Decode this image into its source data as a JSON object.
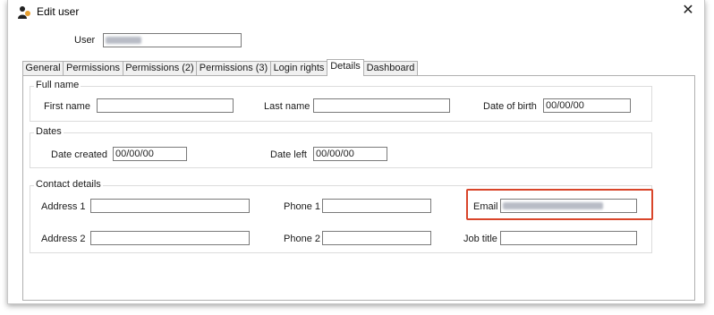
{
  "window": {
    "title": "Edit user",
    "icon": "users-icon",
    "close_glyph": "✕"
  },
  "user": {
    "label": "User",
    "value_blurred": true
  },
  "tabs": [
    {
      "label": "General"
    },
    {
      "label": "Permissions"
    },
    {
      "label": "Permissions (2)"
    },
    {
      "label": "Permissions (3)"
    },
    {
      "label": "Login rights"
    },
    {
      "label": "Details",
      "active": true
    },
    {
      "label": "Dashboard"
    }
  ],
  "full_name": {
    "title": "Full name",
    "first_name_label": "First name",
    "first_name_value": "",
    "last_name_label": "Last name",
    "last_name_value": "",
    "dob_label": "Date of birth",
    "dob_value": "00/00/00"
  },
  "dates": {
    "title": "Dates",
    "created_label": "Date created",
    "created_value": "00/00/00",
    "left_label": "Date left",
    "left_value": "00/00/00"
  },
  "contact": {
    "title": "Contact details",
    "address1_label": "Address 1",
    "address1_value": "",
    "phone1_label": "Phone 1",
    "phone1_value": "",
    "email_label": "Email",
    "email_value_blurred": true,
    "address2_label": "Address 2",
    "address2_value": "",
    "phone2_label": "Phone 2",
    "phone2_value": "",
    "job_title_label": "Job title",
    "job_title_value": ""
  },
  "colors": {
    "highlight": "#d9452a",
    "border": "#7a7a7a"
  }
}
